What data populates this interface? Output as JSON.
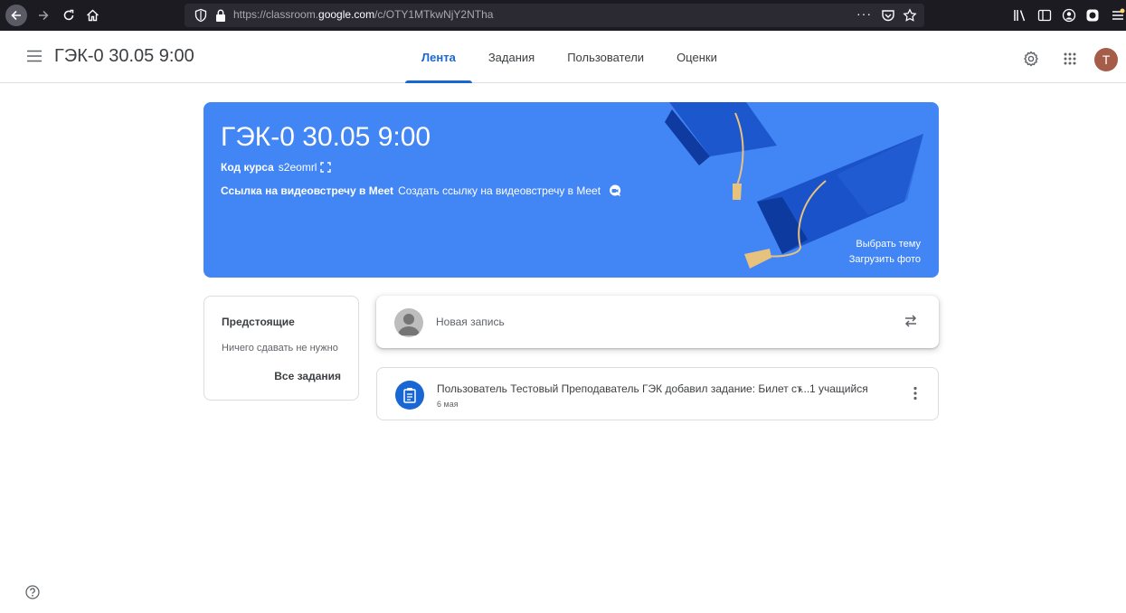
{
  "browser": {
    "url_prefix": "https://classroom.",
    "url_domain": "google.com",
    "url_path": "/c/OTY1MTkwNjY2NTha",
    "url_more": "···"
  },
  "header": {
    "class_title": "ГЭК-0 30.05 9:00",
    "tabs": [
      {
        "label": "Лента",
        "active": true
      },
      {
        "label": "Задания",
        "active": false
      },
      {
        "label": "Пользователи",
        "active": false
      },
      {
        "label": "Оценки",
        "active": false
      }
    ],
    "avatar_letter": "T"
  },
  "banner": {
    "title": "ГЭК-0 30.05 9:00",
    "code_label": "Код курса",
    "code_value": "s2eomrl",
    "meet_label": "Ссылка на видеовстречу в Meet",
    "meet_action": "Создать ссылку на видеовстречу в Meet",
    "select_theme": "Выбрать тему",
    "upload_photo": "Загрузить фото",
    "color": "#4285f4"
  },
  "upcoming": {
    "title": "Предстоящие",
    "empty_text": "Ничего сдавать не нужно",
    "all_link": "Все задания"
  },
  "new_post": {
    "placeholder": "Новая запись"
  },
  "stream": [
    {
      "text": "Пользователь Тестовый Преподаватель ГЭК добавил задание: Билет ст...",
      "audience": "1 учащийся",
      "date": "6 мая"
    }
  ],
  "colors": {
    "accent": "#1967d2",
    "banner": "#4285f4"
  }
}
